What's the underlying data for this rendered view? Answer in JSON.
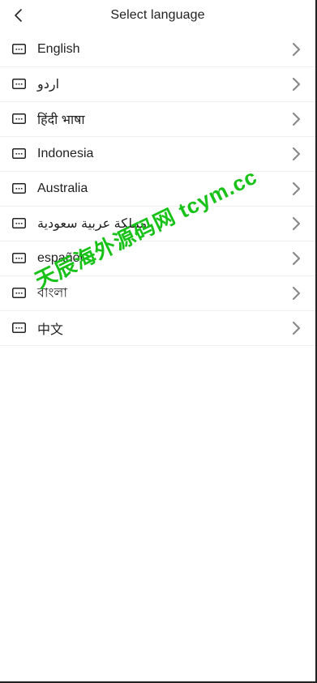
{
  "header": {
    "title": "Select language"
  },
  "languages": [
    {
      "label": "English"
    },
    {
      "label": "اردو"
    },
    {
      "label": "हिंदी भाषा"
    },
    {
      "label": "Indonesia"
    },
    {
      "label": "Australia"
    },
    {
      "label": "مملكة عربية سعودية"
    },
    {
      "label": "español"
    },
    {
      "label": "বাংলা"
    },
    {
      "label": "中文"
    }
  ],
  "watermark": "天辰海外源码网 tcym.cc",
  "colors": {
    "text": "#222222",
    "chevron": "#8a8a8a",
    "divider": "#eeeeee",
    "watermark": "#18c218"
  },
  "icons": {
    "back": "chevron-left-icon",
    "row_flag": "flag-placeholder-icon",
    "row_arrow": "chevron-right-icon"
  }
}
